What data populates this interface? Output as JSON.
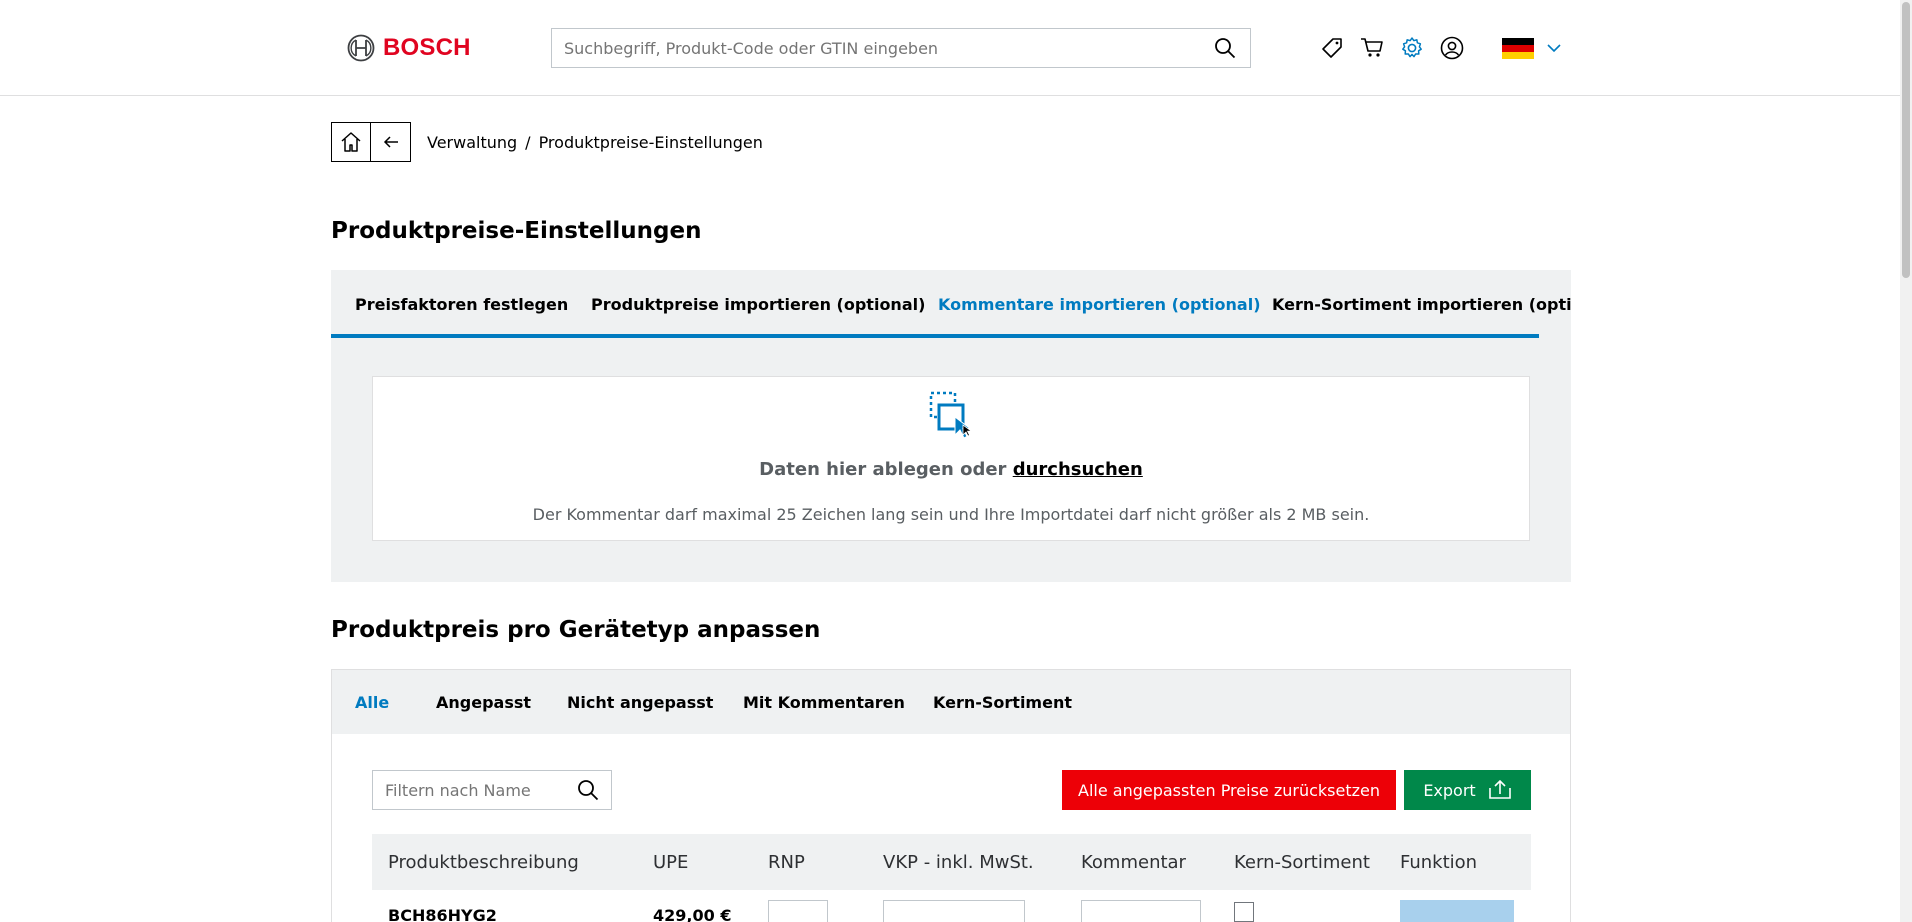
{
  "header": {
    "brand": "BOSCH",
    "search_placeholder": "Suchbegriff, Produkt-Code oder GTIN eingeben",
    "icons": [
      "tag-icon",
      "cart-icon",
      "settings-icon",
      "user-icon"
    ],
    "country": "Deutschland",
    "accent_color": "#007bc0",
    "brand_color": "#e00420"
  },
  "breadcrumb": {
    "items": [
      "Verwaltung",
      "Produktpreise-Einstellungen"
    ],
    "separator": "/"
  },
  "page_title": "Produktpreise-Einstellungen",
  "import_tabs": {
    "items": [
      {
        "label": "Preisfaktoren festlegen",
        "active": false
      },
      {
        "label": "Produktpreise importieren (optional)",
        "active": false
      },
      {
        "label": "Kommentare importieren (optional)",
        "active": true
      },
      {
        "label": "Kern-Sortiment importieren (optional)",
        "active": false
      }
    ]
  },
  "dropzone": {
    "title_prefix": "Daten hier ablegen oder",
    "browse_link": "durchsuchen",
    "note": "Der Kommentar darf maximal 25 Zeichen lang sein und Ihre Importdatei darf nicht größer als 2 MB sein."
  },
  "section_title": "Produktpreis pro Gerätetyp anpassen",
  "filter_tabs": {
    "items": [
      {
        "label": "Alle",
        "active": true
      },
      {
        "label": "Angepasst",
        "active": false
      },
      {
        "label": "Nicht angepasst",
        "active": false
      },
      {
        "label": "Mit Kommentaren",
        "active": false
      },
      {
        "label": "Kern-Sortiment",
        "active": false
      }
    ]
  },
  "toolbar": {
    "filter_placeholder": "Filtern nach Name",
    "reset_label": "Alle angepassten Preise zurücksetzen",
    "export_label": "Export"
  },
  "table": {
    "columns": [
      "Produktbeschreibung",
      "UPE",
      "RNP",
      "VKP - inkl. MwSt.",
      "Kommentar",
      "Kern-Sortiment",
      "Funktion"
    ],
    "rows": [
      {
        "product": "BCH86HYG2",
        "upe": "429,00 €"
      }
    ]
  }
}
